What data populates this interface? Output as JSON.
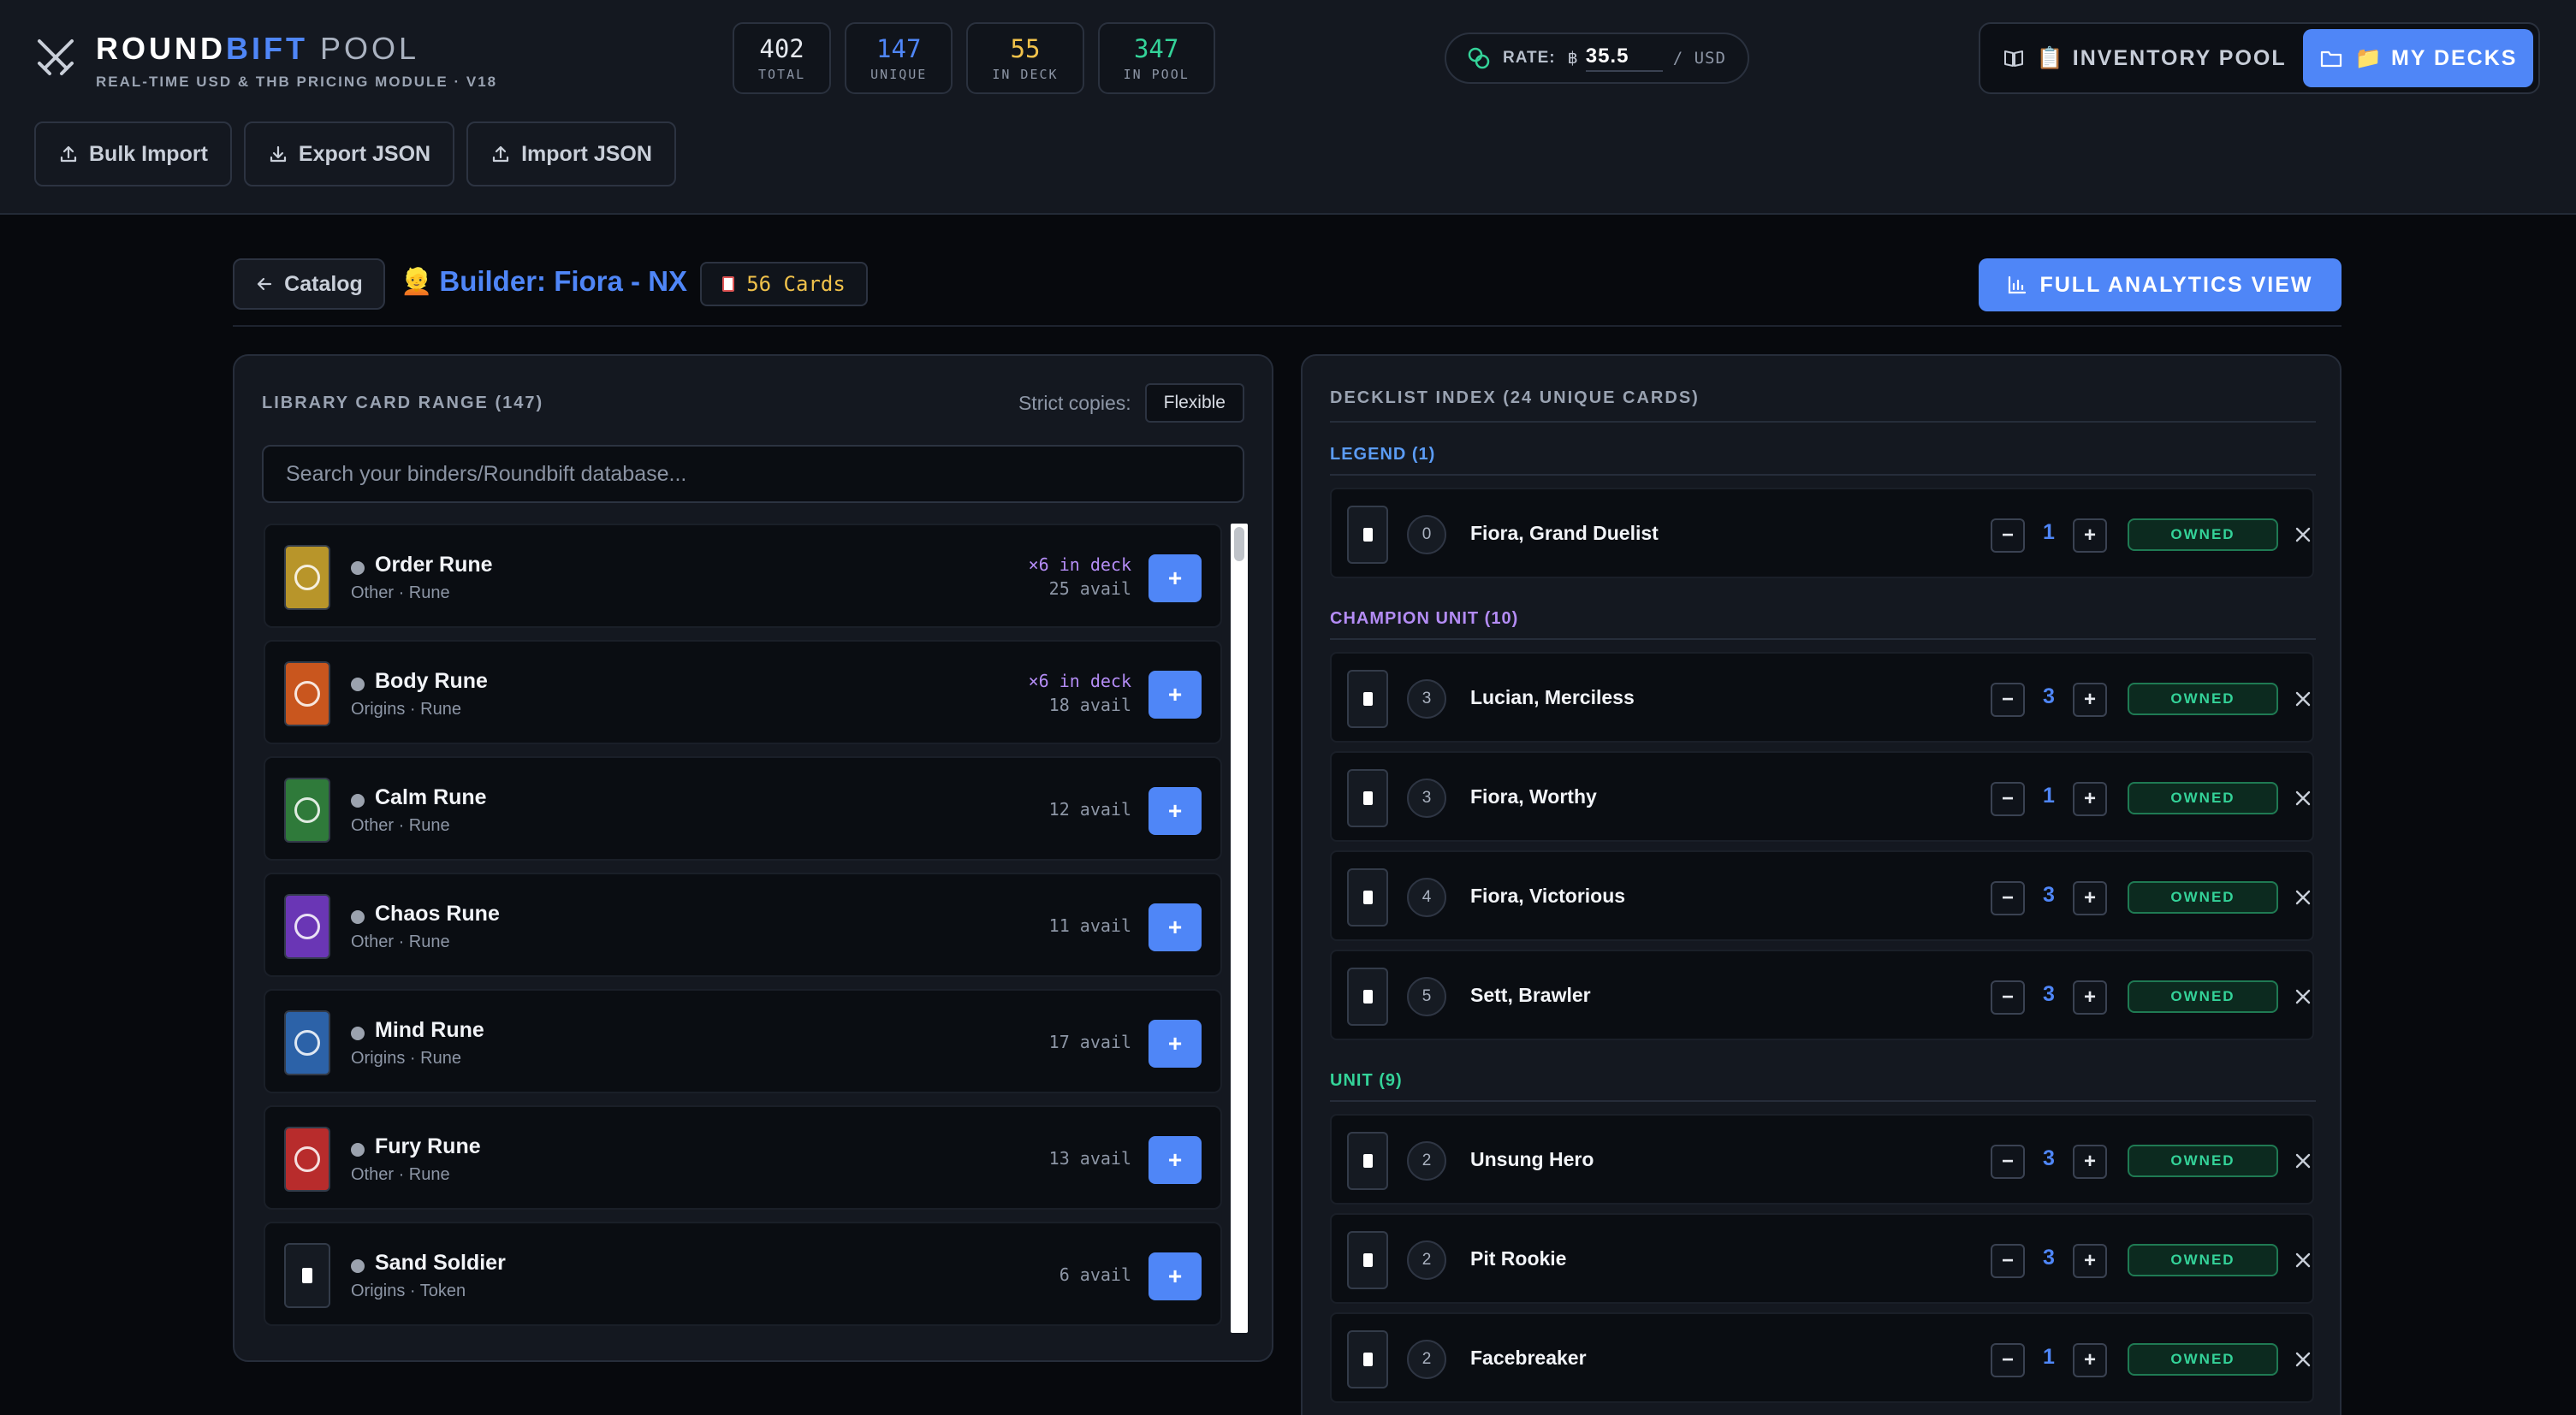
{
  "brand": {
    "title_main": "ROUNDBIFT",
    "title_pool": " POOL",
    "subtitle": "REAL-TIME USD & THB PRICING MODULE · V18"
  },
  "stats": [
    {
      "value": "402",
      "label": "TOTAL",
      "color": "#e6e9ef"
    },
    {
      "value": "147",
      "label": "UNIQUE",
      "color": "#4f86f7"
    },
    {
      "value": "55",
      "label": "IN DECK",
      "color": "#f1c24b"
    },
    {
      "value": "347",
      "label": "IN POOL",
      "color": "#34d399"
    }
  ],
  "rate": {
    "label": "RATE:",
    "currency_symbol": "฿",
    "value": "35.5",
    "unit": "/ USD"
  },
  "nav": {
    "inventory": "📋 INVENTORY POOL",
    "decks": "📁 MY DECKS"
  },
  "toolbar": {
    "bulk_import": "Bulk Import",
    "export_json": "Export JSON",
    "import_json": "Import JSON"
  },
  "builder": {
    "back_label": "Catalog",
    "title_emoji": "👱",
    "title": "Builder: Fiora - NX",
    "cards_count": "56 Cards",
    "analytics_label": "FULL ANALYTICS VIEW"
  },
  "library": {
    "heading": "LIBRARY CARD RANGE (147)",
    "strict_label": "Strict copies:",
    "strict_value": "Flexible",
    "search_placeholder": "Search your binders/Roundbift database...",
    "items": [
      {
        "name": "Order Rune",
        "meta": "Other · Rune",
        "in_deck": "×6 in deck",
        "avail": "25 avail",
        "thumb_color": "#b8952a"
      },
      {
        "name": "Body Rune",
        "meta": "Origins · Rune",
        "in_deck": "×6 in deck",
        "avail": "18 avail",
        "thumb_color": "#c9561e"
      },
      {
        "name": "Calm Rune",
        "meta": "Other · Rune",
        "in_deck": "",
        "avail": "12 avail",
        "thumb_color": "#2f7a3a"
      },
      {
        "name": "Chaos Rune",
        "meta": "Other · Rune",
        "in_deck": "",
        "avail": "11 avail",
        "thumb_color": "#6a36b5"
      },
      {
        "name": "Mind Rune",
        "meta": "Origins · Rune",
        "in_deck": "",
        "avail": "17 avail",
        "thumb_color": "#2c62a8"
      },
      {
        "name": "Fury Rune",
        "meta": "Other · Rune",
        "in_deck": "",
        "avail": "13 avail",
        "thumb_color": "#b82c2c"
      },
      {
        "name": "Sand Soldier",
        "meta": "Origins · Token",
        "in_deck": "",
        "avail": "6 avail",
        "thumb_color": ""
      }
    ],
    "add_label": "+"
  },
  "decklist": {
    "heading": "DECKLIST INDEX (24 UNIQUE CARDS)",
    "owned_label": "OWNED",
    "sections": [
      {
        "title": "LEGEND (1)",
        "color": "#5b9cf6",
        "cards": [
          {
            "cost": "0",
            "name": "Fiora, Grand Duelist",
            "qty": "1"
          }
        ]
      },
      {
        "title": "CHAMPION UNIT (10)",
        "color": "#b48cf5",
        "cards": [
          {
            "cost": "3",
            "name": "Lucian, Merciless",
            "qty": "3"
          },
          {
            "cost": "3",
            "name": "Fiora, Worthy",
            "qty": "1"
          },
          {
            "cost": "4",
            "name": "Fiora, Victorious",
            "qty": "3"
          },
          {
            "cost": "5",
            "name": "Sett, Brawler",
            "qty": "3"
          }
        ]
      },
      {
        "title": "UNIT (9)",
        "color": "#34d399",
        "cards": [
          {
            "cost": "2",
            "name": "Unsung Hero",
            "qty": "3"
          },
          {
            "cost": "2",
            "name": "Pit Rookie",
            "qty": "3"
          },
          {
            "cost": "2",
            "name": "Facebreaker",
            "qty": "1"
          }
        ]
      }
    ]
  }
}
